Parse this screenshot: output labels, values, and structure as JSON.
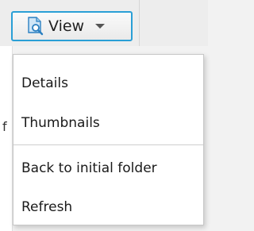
{
  "left_strip_text": "f",
  "view_button": {
    "label": "View",
    "icon": "document-search-icon",
    "caret_icon": "caret-down-icon"
  },
  "menu": {
    "items": [
      {
        "label": "Details"
      },
      {
        "label": "Thumbnails"
      },
      {
        "label": "Back to initial folder"
      },
      {
        "label": "Refresh"
      }
    ]
  },
  "colors": {
    "accent_border": "#2a9fd6",
    "icon_blue": "#2a7fc1"
  }
}
